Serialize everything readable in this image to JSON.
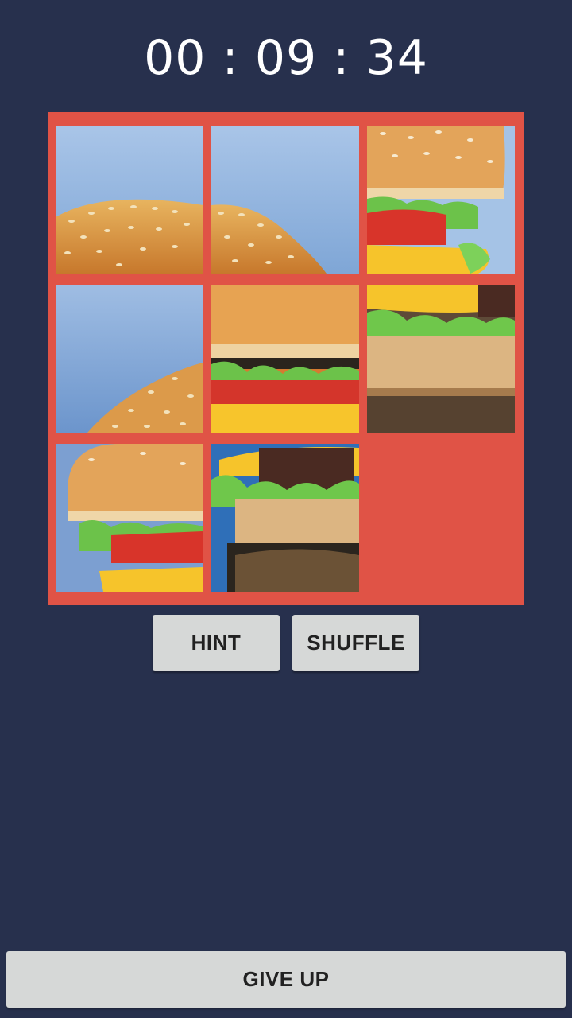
{
  "timer": {
    "hours": "00",
    "minutes": "09",
    "seconds": "34",
    "display": "00 : 09 : 34"
  },
  "puzzle": {
    "grid": "3x3",
    "image_subject": "hamburger",
    "empty_slot": "bottom-right",
    "frame_color": "#e05346",
    "tiles": [
      {
        "row": 1,
        "col": 1,
        "content": "top bun edge on blue"
      },
      {
        "row": 1,
        "col": 2,
        "content": "top bun edge on blue"
      },
      {
        "row": 1,
        "col": 3,
        "content": "bun with lettuce and tomato"
      },
      {
        "row": 2,
        "col": 1,
        "content": "top bun edge on blue"
      },
      {
        "row": 2,
        "col": 2,
        "content": "bun lettuce tomato cheese"
      },
      {
        "row": 2,
        "col": 3,
        "content": "cheese lettuce bottom bun"
      },
      {
        "row": 3,
        "col": 1,
        "content": "bun lettuce tomato cheese"
      },
      {
        "row": 3,
        "col": 2,
        "content": "lettuce patty bottom bun"
      }
    ]
  },
  "buttons": {
    "hint": "HINT",
    "shuffle": "SHUFFLE",
    "give_up": "GIVE UP"
  },
  "colors": {
    "background": "#27304d",
    "button": "#d6d8d7",
    "button_text": "#212121"
  }
}
